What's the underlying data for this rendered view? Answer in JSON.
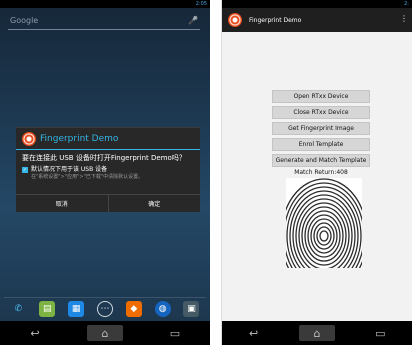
{
  "left_phone": {
    "status_time": "2:05",
    "search_placeholder": "Google",
    "dialog": {
      "title": "Fingerprint Demo",
      "message": "要在连接此 USB 设备时打开Fingerprint Demo吗？",
      "checkbox_label": "默认情况下用于该 USB 设备",
      "checkbox_hint": "在\"系统设置\">\"应用\">\"已下载\"中清除默认设置。",
      "cancel_label": "取消",
      "ok_label": "确定"
    }
  },
  "right_phone": {
    "status_time": "2:",
    "app_title": "Fingerprint Demo",
    "buttons": [
      "Open RTxx Device",
      "Close RTxx Device",
      "Get Fingerprint Image",
      "Enrol Template",
      "Generate and Match Template"
    ],
    "match_text": "Match Return:408"
  },
  "colors": {
    "accent": "#33b5e5",
    "dialog_bg": "#282828",
    "button_bg": "#d6d6d6"
  },
  "icons": {
    "nav": [
      "back-icon",
      "home-icon",
      "recent-apps-icon"
    ],
    "dock": [
      "phone-icon",
      "messages-icon",
      "contacts-icon",
      "app-drawer-icon",
      "store-icon",
      "browser-icon",
      "gallery-icon"
    ]
  }
}
